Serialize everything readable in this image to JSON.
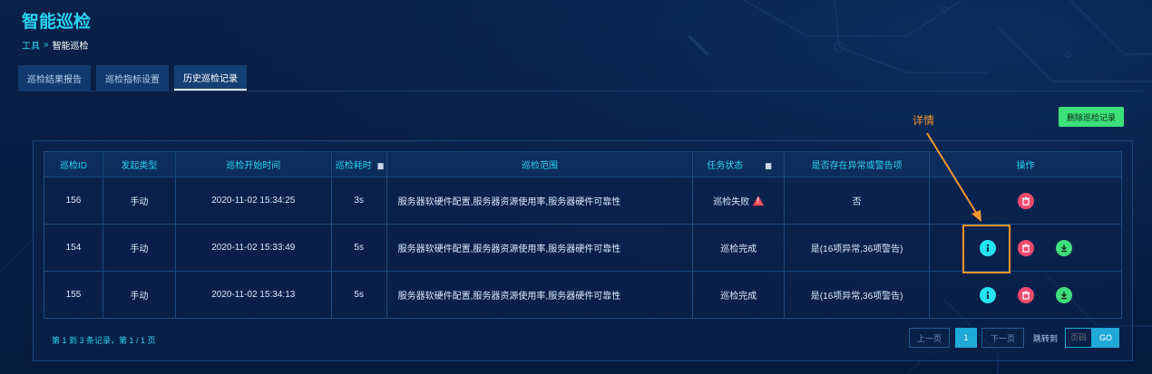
{
  "page": {
    "title": "智能巡检",
    "breadcrumb": {
      "parent": "工具",
      "separator": "»",
      "current": "智能巡检"
    }
  },
  "tabs": [
    {
      "label": "巡检结果报告",
      "active": false
    },
    {
      "label": "巡检指标设置",
      "active": false
    },
    {
      "label": "历史巡检记录",
      "active": true
    }
  ],
  "toolbar": {
    "delete_records_label": "删除巡检记录"
  },
  "annotation": {
    "label": "详情"
  },
  "table": {
    "headers": [
      "巡检ID",
      "发起类型",
      "巡检开始时间",
      "巡检耗时",
      "巡检范围",
      "任务状态",
      "是否存在异常或警告项",
      "操作"
    ],
    "rows": [
      {
        "id": "156",
        "type": "手动",
        "start": "2020-11-02 15:34:25",
        "duration": "3s",
        "scope": "服务器软硬件配置,服务器资源使用率,服务器硬件可靠性",
        "status": "巡检失败",
        "status_warning": true,
        "anomaly": "否",
        "ops": [
          "delete"
        ]
      },
      {
        "id": "154",
        "type": "手动",
        "start": "2020-11-02 15:33:49",
        "duration": "5s",
        "scope": "服务器软硬件配置,服务器资源使用率,服务器硬件可靠性",
        "status": "巡检完成",
        "status_warning": false,
        "anomaly": "是(16项异常,36项警告)",
        "ops": [
          "info",
          "delete",
          "download"
        ]
      },
      {
        "id": "155",
        "type": "手动",
        "start": "2020-11-02 15:34:13",
        "duration": "5s",
        "scope": "服务器软硬件配置,服务器资源使用率,服务器硬件可靠性",
        "status": "巡检完成",
        "status_warning": false,
        "anomaly": "是(16项异常,36项警告)",
        "ops": [
          "info",
          "delete",
          "download"
        ]
      }
    ]
  },
  "pagination": {
    "summary": "第 1 到 3 条记录，第 1 / 1 页",
    "prev_label": "上一页",
    "current_page": "1",
    "next_label": "下一页",
    "jump_label": "跳转到",
    "input_placeholder": "页码",
    "go_label": "GO"
  },
  "colors": {
    "accent": "#27d4f0",
    "annotation": "#f2962f",
    "danger": "#f04a6e",
    "success": "#3fe07c"
  }
}
